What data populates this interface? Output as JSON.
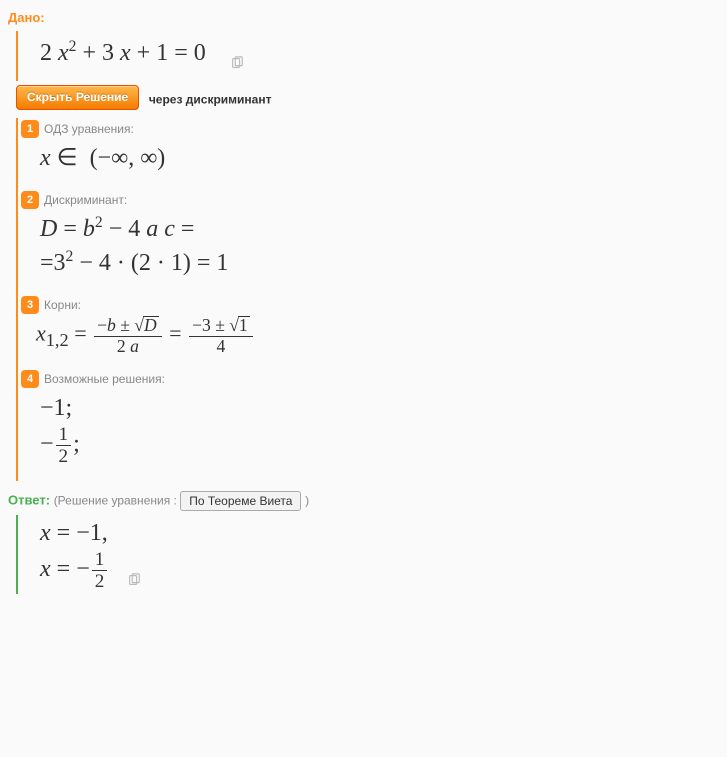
{
  "given_label": "Дано:",
  "equation": "2 x² + 3 x + 1 = 0",
  "hide_button_label": "Скрыть Решение",
  "method_label": "через дискриминант",
  "steps": [
    {
      "n": "1",
      "title": "ОДЗ уравнения:",
      "body": "x ∈  (−∞, ∞)"
    },
    {
      "n": "2",
      "title": "Дискриминант:",
      "body_line1": "D = b² − 4 a c =",
      "body_line2": "=3² − 4 · (2 · 1) = 1"
    },
    {
      "n": "3",
      "title": "Корни:",
      "prefix": "x",
      "sub": "1,2",
      "eq": " = ",
      "num1": "−b ± √D",
      "den1": "2 a",
      "num2": "−3 ± √1",
      "den2": "4"
    },
    {
      "n": "4",
      "title": "Возможные решения:",
      "sol1": "−1;",
      "sol2_pre": "−",
      "sol2_num": "1",
      "sol2_den": "2",
      "sol2_post": ";"
    }
  ],
  "answer_label": "Ответ:",
  "answer_paren_pre": "(Решение уравнения : ",
  "vieta_label": "По Теореме Виета",
  "answer_paren_post": " )",
  "answer_line1": "x = −1,",
  "answer_line2_pre": "x = −",
  "answer_line2_num": "1",
  "answer_line2_den": "2",
  "chart_data": {
    "type": "table",
    "title": "Quadratic equation solution via discriminant",
    "equation": "2x^2 + 3x + 1 = 0",
    "coefficients": {
      "a": 2,
      "b": 3,
      "c": 1
    },
    "domain": "(-inf, inf)",
    "discriminant_formula": "D = b^2 - 4ac",
    "discriminant_value": 1,
    "roots_formula": "x_{1,2} = (-b ± sqrt(D)) / (2a) = (-3 ± sqrt(1)) / 4",
    "solutions": [
      -1,
      -0.5
    ],
    "answer": [
      "x = -1",
      "x = -1/2"
    ]
  }
}
